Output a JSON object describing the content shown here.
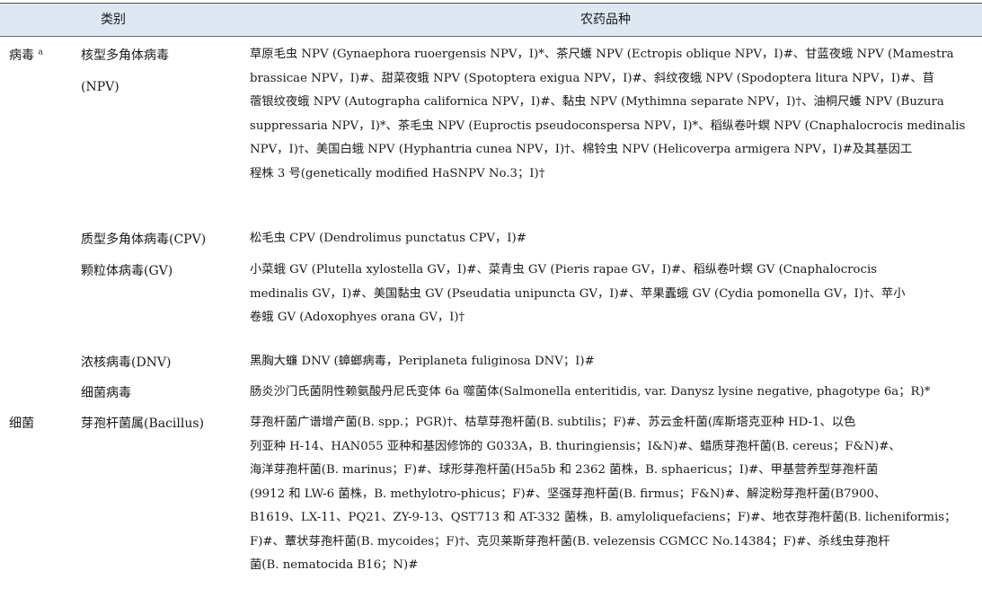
{
  "header": {
    "category_label": "类别",
    "varieties_label": "农药品种"
  },
  "groups": [
    {
      "name": "病毒",
      "name_mark": "a",
      "rows": [
        {
          "subcategory": "核型多角体病毒",
          "subcategory_line2": "(NPV)",
          "text": "草原毛虫 NPV (Gynaephora ruoergensis NPV，I)*、茶尺蠖 NPV (Ectropis oblique NPV，I)#、甘蓝夜蛾 NPV (Mamestra\nbrassicae NPV，I)#、甜菜夜蛾 NPV (Spotoptera exigua NPV，I)#、斜纹夜蛾 NPV (Spodoptera litura NPV，I)#、苜\n蓿银纹夜蛾 NPV (Autographa californica NPV，I)#、黏虫 NPV (Mythimna separate NPV，I)†、油桐尺蠖 NPV (Buzura\nsuppressaria NPV，I)*、茶毛虫 NPV (Euproctis pseudoconspersa NPV，I)*、稻纵卷叶螟 NPV (Cnaphalocrocis medinalis\nNPV，I)†、美国白蛾 NPV (Hyphantria cunea NPV，I)†、棉铃虫 NPV (Helicoverpa armigera NPV，I)#及其基因工\n程株 3 号(genetically modified HaSNPV No.3；I)†"
        },
        {
          "subcategory": "质型多角体病毒(CPV)",
          "text": "松毛虫 CPV (Dendrolimus punctatus CPV，I)#"
        },
        {
          "subcategory": "颗粒体病毒(GV)",
          "text": "小菜蛾 GV (Plutella xylostella GV，I)#、菜青虫 GV (Pieris rapae GV，I)#、稻纵卷叶螟 GV (Cnaphalocrocis\nmedinalis GV，I)#、美国黏虫 GV (Pseudatia unipuncta GV，I)#、苹果蠹蛾 GV (Cydia pomonella GV，I)†、苹小\n卷蛾 GV (Adoxophyes orana GV，I)†"
        },
        {
          "subcategory": "浓核病毒(DNV)",
          "text": "黑胸大蠊 DNV (蟑螂病毒，Periplaneta fuliginosa DNV；I)#"
        },
        {
          "subcategory": "细菌病毒",
          "text": "肠炎沙门氏菌阴性赖氨酸丹尼氏变体 6a 噬菌体(Salmonella enteritidis, var. Danysz lysine negative, phagotype 6a；R)*"
        }
      ]
    },
    {
      "name": "细菌",
      "rows": [
        {
          "subcategory": "芽孢杆菌属(Bacillus)",
          "text": "芽孢杆菌广谱增产菌(B. spp.；PGR)†、枯草芽孢杆菌(B. subtilis；F)#、苏云金杆菌(库斯塔克亚种 HD-1、以色\n列亚种 H-14、HAN055 亚种和基因修饰的 G033A，B. thuringiensis；I&N)#、蜡质芽孢杆菌(B. cereus；F&N)#、\n海洋芽孢杆菌(B. marinus；F)#、球形芽孢杆菌(H5a5b 和 2362 菌株，B. sphaericus；I)#、甲基营养型芽孢杆菌\n(9912 和 LW-6 菌株，B. methylotro-phicus；F)#、坚强芽孢杆菌(B. firmus；F&N)#、解淀粉芽孢杆菌(B7900、\nB1619、LX-11、PQ21、ZY-9-13、QST713 和 AT-332 菌株，B. amyloliquefaciens；F)#、地衣芽孢杆菌(B. licheniformis；\nF)#、蕈状芽孢杆菌(B. mycoides；F)†、克贝莱斯芽孢杆菌(B. velezensis CGMCC No.14384；F)#、杀线虫芽孢杆\n菌(B. nematocida B16；N)#"
        }
      ]
    }
  ]
}
